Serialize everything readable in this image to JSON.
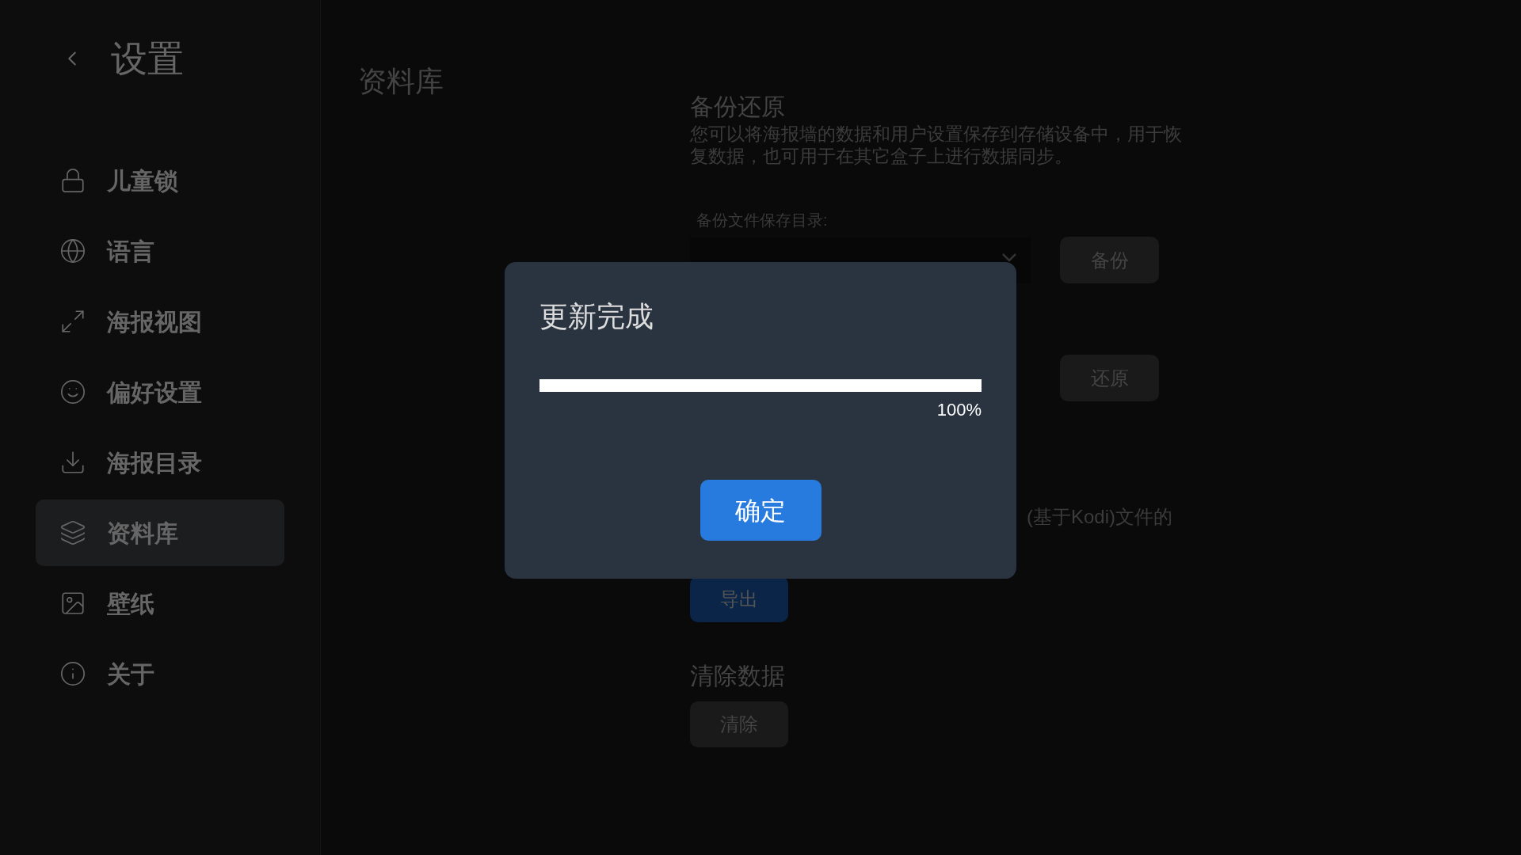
{
  "sidebar": {
    "title": "设置",
    "items": [
      {
        "label": "儿童锁",
        "kind": "lock",
        "selected": false
      },
      {
        "label": "语言",
        "kind": "globe",
        "selected": false
      },
      {
        "label": "海报视图",
        "kind": "expand",
        "selected": false
      },
      {
        "label": "偏好设置",
        "kind": "smile",
        "selected": false
      },
      {
        "label": "海报目录",
        "kind": "download",
        "selected": false
      },
      {
        "label": "资料库",
        "kind": "layers",
        "selected": true
      },
      {
        "label": "壁纸",
        "kind": "image",
        "selected": false
      },
      {
        "label": "关于",
        "kind": "info",
        "selected": false
      }
    ]
  },
  "page_title": "资料库",
  "backup": {
    "heading": "备份还原",
    "description": "您可以将海报墙的数据和用户设置保存到存储设备中，用于恢复数据，也可用于在其它盒子上进行数据同步。",
    "dir_label": "备份文件保存目录:",
    "backup_button": "备份",
    "restore_button": "还原"
  },
  "export": {
    "description_tail": "(基于Kodi)文件的",
    "button": "导出"
  },
  "clear": {
    "heading": "清除数据",
    "button": "清除"
  },
  "dialog": {
    "title": "更新完成",
    "level": 1,
    "reading": "100%",
    "button": "确定"
  }
}
